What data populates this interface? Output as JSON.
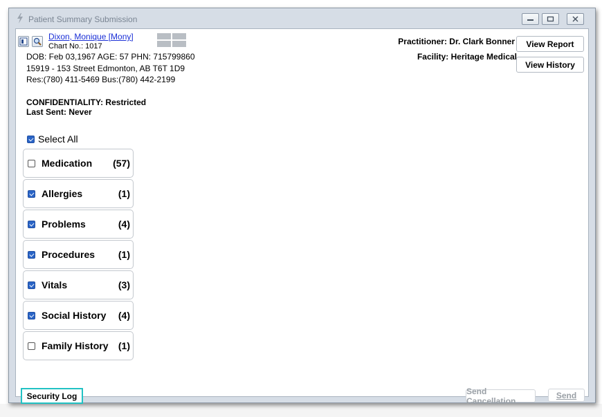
{
  "window": {
    "title": "Patient Summary Submission"
  },
  "patient": {
    "name": "Dixon, Monique [Mony]",
    "chart_no": "Chart No.: 1017",
    "dob_line": "DOB: Feb 03,1967  AGE: 57   PHN: 715799860",
    "address": "15919 - 153 Street Edmonton, AB  T6T 1D9",
    "phones": "Res:(780) 411-5469 Bus:(780) 442-2199",
    "confidentiality": "CONFIDENTIALITY: Restricted",
    "last_sent": "Last Sent: Never"
  },
  "header_right": {
    "practitioner": "Practitioner: Dr. Clark Bonner",
    "facility": "Facility: Heritage Medical",
    "view_report": "View Report",
    "view_history": "View History"
  },
  "select_all": {
    "label": "Select All",
    "checked": true
  },
  "categories": [
    {
      "label": "Medication",
      "count": "(57)",
      "checked": false
    },
    {
      "label": "Allergies",
      "count": "(1)",
      "checked": true
    },
    {
      "label": "Problems",
      "count": "(4)",
      "checked": true
    },
    {
      "label": "Procedures",
      "count": "(1)",
      "checked": true
    },
    {
      "label": "Vitals",
      "count": "(3)",
      "checked": true
    },
    {
      "label": "Social History",
      "count": "(4)",
      "checked": true
    },
    {
      "label": "Family History",
      "count": "(1)",
      "checked": false
    }
  ],
  "footer": {
    "security_log": "Security Log",
    "send_cancellation": "Send Cancellation",
    "send": "Send"
  },
  "colors": {
    "accent": "#2a64c6",
    "link": "#1a2fd6",
    "highlight": "#21c2c4"
  }
}
